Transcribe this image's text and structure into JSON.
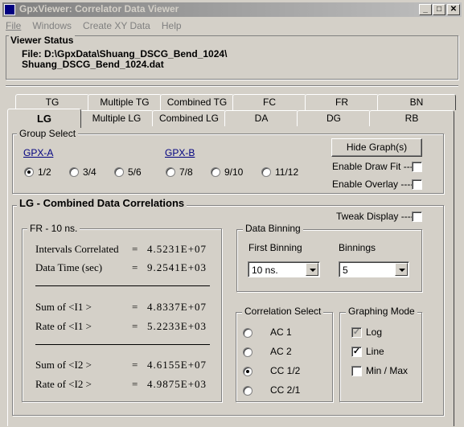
{
  "window": {
    "title": "GpxViewer: Correlator Data Viewer",
    "min": "_",
    "max": "□",
    "close": "✕"
  },
  "menu": [
    "File",
    "Windows",
    "Create XY Data",
    "Help"
  ],
  "viewer_status": {
    "title": "Viewer  Status",
    "line1": "File: D:\\GpxData\\Shuang_DSCG_Bend_1024\\",
    "line2": "Shuang_DSCG_Bend_1024.dat"
  },
  "tabs_row1": [
    "TG",
    "Multiple TG",
    "Combined TG",
    "FC",
    "FR",
    "BN"
  ],
  "tabs_row2": [
    "LG",
    "Multiple LG",
    "Combined LG",
    "DA",
    "DG",
    "RB"
  ],
  "group_select": {
    "title": "Group Select",
    "gpx_a": "GPX-A",
    "gpx_b": "GPX-B",
    "radios": [
      "1/2",
      "3/4",
      "5/6",
      "7/8",
      "9/10",
      "11/12"
    ],
    "selected": "1/2",
    "hide_graphs": "Hide Graph(s)",
    "enable_draw_fit": "Enable Draw Fit ----",
    "enable_overlay": "Enable Overlay ----"
  },
  "panel": {
    "title": "LG - Combined Data Correlations",
    "tweak_display": "Tweak Display ----"
  },
  "fr_box": {
    "title": "FR - 10 ns.",
    "rows": [
      {
        "label": "Intervals Correlated",
        "eq": "=",
        "value": "4.5231E+07"
      },
      {
        "label": "Data Time (sec)",
        "eq": "=",
        "value": "9.2541E+03"
      },
      {
        "label": "Sum  of <I1 >",
        "eq": "=",
        "value": "4.8337E+07"
      },
      {
        "label": "Rate  of <I1 >",
        "eq": "=",
        "value": "5.2233E+03"
      },
      {
        "label": "Sum  of <I2 >",
        "eq": "=",
        "value": "4.6155E+07"
      },
      {
        "label": "Rate  of <I2 >",
        "eq": "=",
        "value": "4.9875E+03"
      }
    ]
  },
  "data_binning": {
    "title": "Data Binning",
    "first_label": "First Binning",
    "first_value": "10 ns.",
    "bin_label": "Binnings",
    "bin_value": "5"
  },
  "correlation_select": {
    "title": "Correlation Select",
    "options": [
      "AC  1",
      "AC  2",
      "CC  1/2",
      "CC  2/1"
    ],
    "selected": "CC  1/2"
  },
  "graphing_mode": {
    "title": "Graphing  Mode",
    "log": "Log",
    "line": "Line",
    "minmax": "Min / Max",
    "check": "✓"
  }
}
